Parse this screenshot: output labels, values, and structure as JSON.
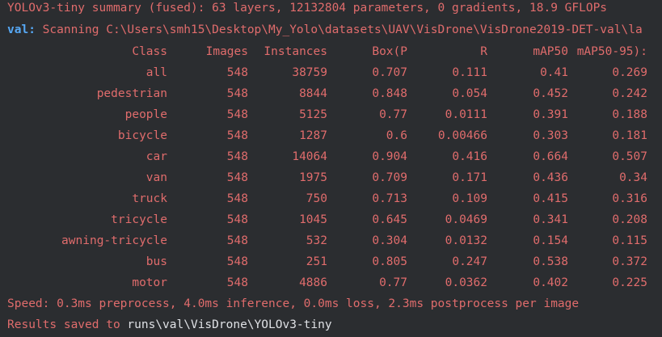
{
  "summary_line": "YOLOv3-tiny summary (fused): 63 layers, 12132804 parameters, 0 gradients, 18.9 GFLOPs",
  "scan": {
    "prefix": "val:",
    "text": " Scanning C:\\Users\\smh15\\Desktop\\My_Yolo\\datasets\\UAV\\VisDrone\\VisDrone2019-DET-val\\la"
  },
  "table": {
    "headers": {
      "class": "Class",
      "images": "Images",
      "instances": "Instances",
      "p": "Box(P",
      "r": "R",
      "map50": "mAP50",
      "map5095": "mAP50-95):"
    },
    "rows": [
      {
        "class": "all",
        "images": "548",
        "instances": "38759",
        "p": "0.707",
        "r": "0.111",
        "map50": "0.41",
        "map5095": "0.269"
      },
      {
        "class": "pedestrian",
        "images": "548",
        "instances": "8844",
        "p": "0.848",
        "r": "0.054",
        "map50": "0.452",
        "map5095": "0.242"
      },
      {
        "class": "people",
        "images": "548",
        "instances": "5125",
        "p": "0.77",
        "r": "0.0111",
        "map50": "0.391",
        "map5095": "0.188"
      },
      {
        "class": "bicycle",
        "images": "548",
        "instances": "1287",
        "p": "0.6",
        "r": "0.00466",
        "map50": "0.303",
        "map5095": "0.181"
      },
      {
        "class": "car",
        "images": "548",
        "instances": "14064",
        "p": "0.904",
        "r": "0.416",
        "map50": "0.664",
        "map5095": "0.507"
      },
      {
        "class": "van",
        "images": "548",
        "instances": "1975",
        "p": "0.709",
        "r": "0.171",
        "map50": "0.436",
        "map5095": "0.34"
      },
      {
        "class": "truck",
        "images": "548",
        "instances": "750",
        "p": "0.713",
        "r": "0.109",
        "map50": "0.415",
        "map5095": "0.316"
      },
      {
        "class": "tricycle",
        "images": "548",
        "instances": "1045",
        "p": "0.645",
        "r": "0.0469",
        "map50": "0.341",
        "map5095": "0.208"
      },
      {
        "class": "awning-tricycle",
        "images": "548",
        "instances": "532",
        "p": "0.304",
        "r": "0.0132",
        "map50": "0.154",
        "map5095": "0.115"
      },
      {
        "class": "bus",
        "images": "548",
        "instances": "251",
        "p": "0.805",
        "r": "0.247",
        "map50": "0.538",
        "map5095": "0.372"
      },
      {
        "class": "motor",
        "images": "548",
        "instances": "4886",
        "p": "0.77",
        "r": "0.0362",
        "map50": "0.402",
        "map5095": "0.225"
      }
    ]
  },
  "speed_line": "Speed: 0.3ms preprocess, 4.0ms inference, 0.0ms loss, 2.3ms postprocess per image",
  "results": {
    "prefix": "Results saved to ",
    "path": "runs\\val\\VisDrone\\YOLOv3-tiny"
  },
  "colors": {
    "background": "#2b2d30",
    "text_red": "#e06c6c",
    "text_blue": "#56a8f5",
    "text_white": "#dfe1e5"
  }
}
